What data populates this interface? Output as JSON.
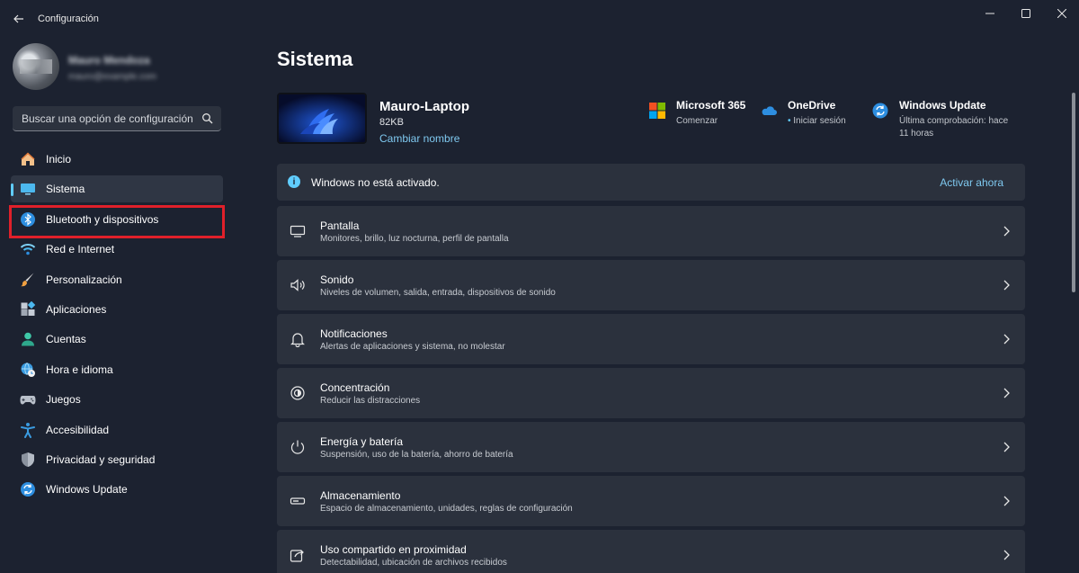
{
  "window": {
    "title": "Configuración"
  },
  "user": {
    "name": "Mauro Mendoza",
    "email": "mauro@example.com"
  },
  "search": {
    "placeholder": "Buscar una opción de configuración"
  },
  "sidebar": {
    "items": [
      {
        "label": "Inicio",
        "icon": "home-icon"
      },
      {
        "label": "Sistema",
        "icon": "system-icon",
        "active": true
      },
      {
        "label": "Bluetooth y dispositivos",
        "icon": "bluetooth-icon",
        "highlighted": true
      },
      {
        "label": "Red e Internet",
        "icon": "wifi-icon"
      },
      {
        "label": "Personalización",
        "icon": "brush-icon"
      },
      {
        "label": "Aplicaciones",
        "icon": "apps-icon"
      },
      {
        "label": "Cuentas",
        "icon": "person-icon"
      },
      {
        "label": "Hora e idioma",
        "icon": "globe-clock-icon"
      },
      {
        "label": "Juegos",
        "icon": "gamepad-icon"
      },
      {
        "label": "Accesibilidad",
        "icon": "accessibility-icon"
      },
      {
        "label": "Privacidad y seguridad",
        "icon": "shield-icon"
      },
      {
        "label": "Windows Update",
        "icon": "update-icon"
      }
    ]
  },
  "main": {
    "title": "Sistema",
    "device": {
      "name": "Mauro-Laptop",
      "storage": "82KB",
      "rename_label": "Cambiar nombre"
    },
    "quick_links": [
      {
        "title": "Microsoft 365",
        "subtitle": "Comenzar",
        "icon": "microsoft-365-icon"
      },
      {
        "title": "OneDrive",
        "subtitle": "Iniciar sesión",
        "icon": "onedrive-icon"
      },
      {
        "title": "Windows Update",
        "subtitle": "Última comprobación: hace 11 horas",
        "icon": "windows-update-icon"
      }
    ],
    "activation": {
      "message": "Windows no está activado.",
      "action": "Activar ahora"
    },
    "settings": [
      {
        "title": "Pantalla",
        "description": "Monitores, brillo, luz nocturna, perfil de pantalla",
        "icon": "display-icon"
      },
      {
        "title": "Sonido",
        "description": "Niveles de volumen, salida, entrada, dispositivos de sonido",
        "icon": "speaker-icon"
      },
      {
        "title": "Notificaciones",
        "description": "Alertas de aplicaciones y sistema, no molestar",
        "icon": "bell-icon"
      },
      {
        "title": "Concentración",
        "description": "Reducir las distracciones",
        "icon": "focus-icon"
      },
      {
        "title": "Energía y batería",
        "description": "Suspensión, uso de la batería, ahorro de batería",
        "icon": "power-icon"
      },
      {
        "title": "Almacenamiento",
        "description": "Espacio de almacenamiento, unidades, reglas de configuración",
        "icon": "storage-icon"
      },
      {
        "title": "Uso compartido en proximidad",
        "description": "Detectabilidad, ubicación de archivos recibidos",
        "icon": "share-icon"
      }
    ]
  },
  "colors": {
    "background": "#1c2230",
    "card": "#2b313d",
    "accent": "#60cdff",
    "link": "#7fc9f0",
    "highlight": "#e0202a"
  }
}
